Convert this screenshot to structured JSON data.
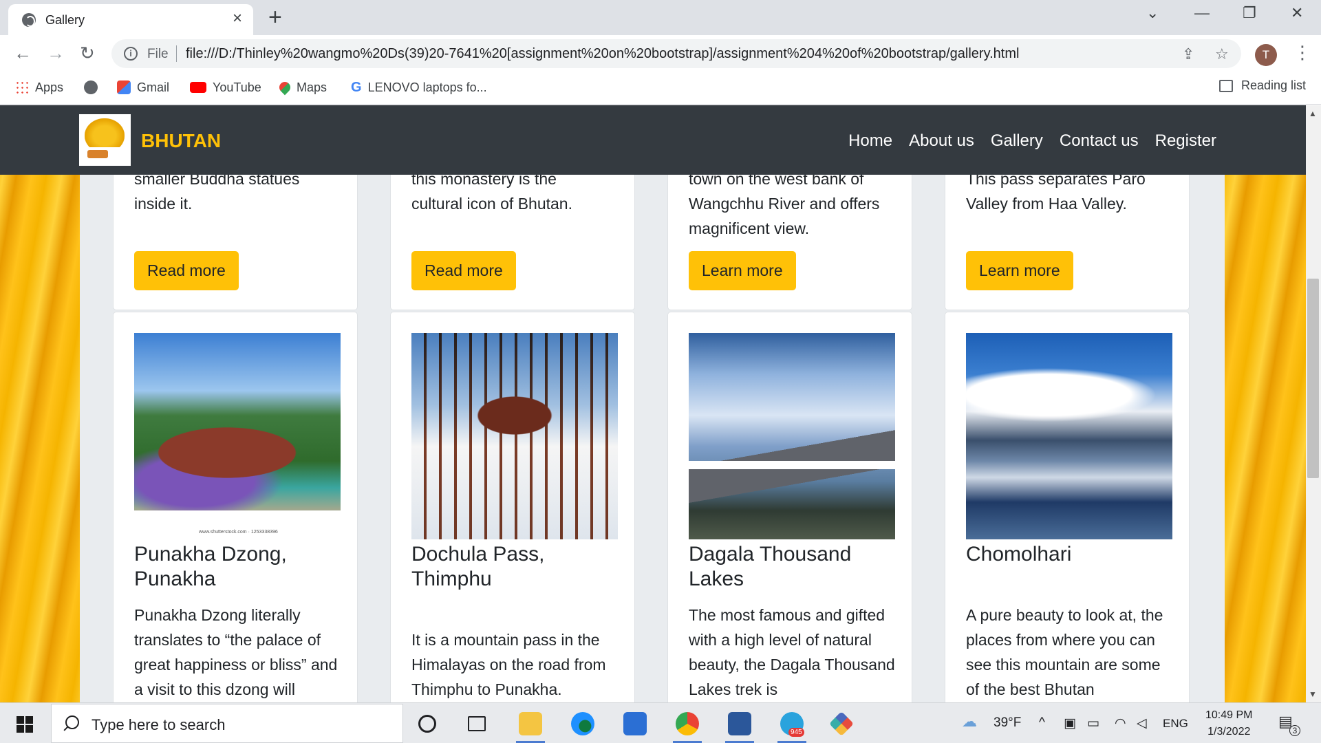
{
  "browser": {
    "tab_title": "Gallery",
    "url_scheme": "File",
    "url": "file:///D:/Thinley%20wangmo%20Ds(39)20-7641%20[assignment%20on%20bootstrap]/assignment%204%20of%20bootstrap/gallery.html",
    "avatar_letter": "T",
    "bookmarks": [
      "Apps",
      "Gmail",
      "YouTube",
      "Maps",
      "LENOVO laptops fo..."
    ],
    "reading_list": "Reading list"
  },
  "site": {
    "brand": "BHUTAN",
    "nav": [
      "Home",
      "About us",
      "Gallery",
      "Contact us",
      "Register"
    ]
  },
  "top_cards": [
    {
      "text_partial": "smaller Buddha statues",
      "text": "inside it.",
      "button": "Read more"
    },
    {
      "text_partial": "this monastery is the",
      "text": "cultural icon of Bhutan.",
      "button": "Read more"
    },
    {
      "text_partial": "town on the west bank of",
      "text": "Wangchhu River and offers magnificent view.",
      "button": "Learn more"
    },
    {
      "text_partial": "This pass separates Paro",
      "text": "Valley from Haa Valley.",
      "button": "Learn more"
    }
  ],
  "bottom_cards": [
    {
      "title": "Punakha Dzong, Punakha",
      "text": "Punakha Dzong literally translates to “the palace of great happiness or bliss” and a visit to this dzong will",
      "image_caption": "www.shutterstock.com · 1253338396"
    },
    {
      "title": "Dochula Pass, Thimphu",
      "text": "It is a mountain pass in the Himalayas on the road from Thimphu to Punakha."
    },
    {
      "title": "Dagala Thousand Lakes",
      "text": "The most famous and gifted with a high level of natural beauty, the Dagala Thousand Lakes trek is"
    },
    {
      "title": "Chomolhari",
      "text": "A pure beauty to look at, the places from where you can see this mountain are some of the best Bhutan"
    }
  ],
  "taskbar": {
    "search_placeholder": "Type here to search",
    "weather": "39°F",
    "language": "ENG",
    "time": "10:49 PM",
    "date": "1/3/2022",
    "telegram_badge": "945",
    "notification_count": "3"
  },
  "colors": {
    "navbar": "#343a40",
    "brand": "#ffc107",
    "button": "#ffc107",
    "page_background": "#e9ecef"
  }
}
